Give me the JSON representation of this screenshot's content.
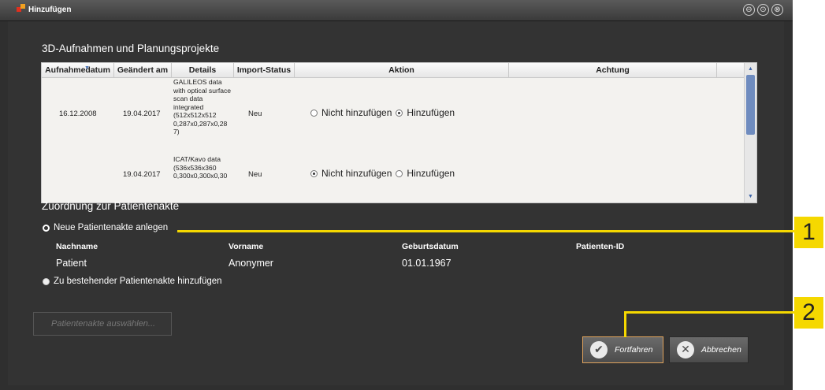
{
  "window": {
    "title": "Hinzufügen",
    "title_buttons": [
      "⊖",
      "⊙",
      "⊗"
    ]
  },
  "recordings": {
    "section_title": "3D-Aufnahmen und Planungsprojekte",
    "columns": [
      "Aufnahmedatum",
      "Geändert am",
      "Details",
      "Import-Status",
      "Aktion",
      "Achtung"
    ],
    "rows": [
      {
        "recorded": "16.12.2008",
        "modified": "19.04.2017",
        "details": "GALILEOS data with optical surface scan data integrated (512x512x512 0,287x0,287x0,28 7)",
        "status": "Neu",
        "option_skip": "Nicht hinzufügen",
        "option_add": "Hinzufügen",
        "selected": "add"
      },
      {
        "recorded": "",
        "modified": "19.04.2017",
        "details": "ICAT/Kavo data (536x536x360 0,300x0,300x0,30",
        "status": "Neu",
        "option_skip": "Nicht hinzufügen",
        "option_add": "Hinzufügen",
        "selected": "skip"
      }
    ]
  },
  "assignment": {
    "section_title": "Zuordnung zur Patientenakte",
    "new_record_label": "Neue Patientenakte anlegen",
    "existing_record_label": "Zu bestehender Patientenakte hinzufügen",
    "patient_headers": {
      "lastname": "Nachname",
      "firstname": "Vorname",
      "birthdate": "Geburtsdatum",
      "patient_id": "Patienten-ID"
    },
    "patient": {
      "lastname": "Patient",
      "firstname": "Anonymer",
      "birthdate": "01.01.1967",
      "patient_id": ""
    },
    "select_record_button": "Patientenakte auswählen..."
  },
  "buttons": {
    "continue": "Fortfahren",
    "cancel": "Abbrechen"
  },
  "callouts": [
    "1",
    "2"
  ],
  "colors": {
    "callout": "#f5d800",
    "window_bg": "#333333",
    "highlight_border": "#e0a35c"
  }
}
